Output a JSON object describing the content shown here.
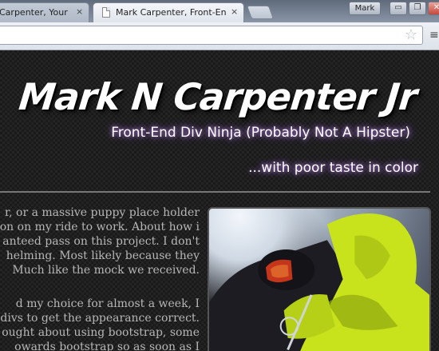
{
  "browser": {
    "tabs": [
      {
        "label": "Carpenter, Your Fr",
        "close": "×"
      },
      {
        "label": "Mark Carpenter, Front-End",
        "close": "×"
      }
    ],
    "profile_label": "Mark",
    "window_buttons": {
      "minimize": "▭",
      "maximize": "❐",
      "close": "✕"
    },
    "icons": {
      "star": "☆",
      "wrench": "≡"
    }
  },
  "site": {
    "title": "Mark N Carpenter Jr",
    "subtitle": "Front-End Div Ninja (Probably Not A Hipster)",
    "tagline": "...with poor taste in color"
  },
  "content": {
    "paragraph1": [
      "r, or a massive puppy place holder",
      "on on my ride to work. About how i",
      "anteed pass on this project. I don't",
      "helming. Most likely because they",
      "Much like the mock we received."
    ],
    "paragraph2": [
      "d my choice for almost a week, I",
      "divs to get the appearance correct.",
      "ought about using bootstrap, some",
      "owards bootstrap so as soon as I"
    ]
  },
  "colors": {
    "title": "#ffffff",
    "glow": "#b07cd8",
    "body_text": "#b7b7b7",
    "jacket": "#c8e21b"
  }
}
